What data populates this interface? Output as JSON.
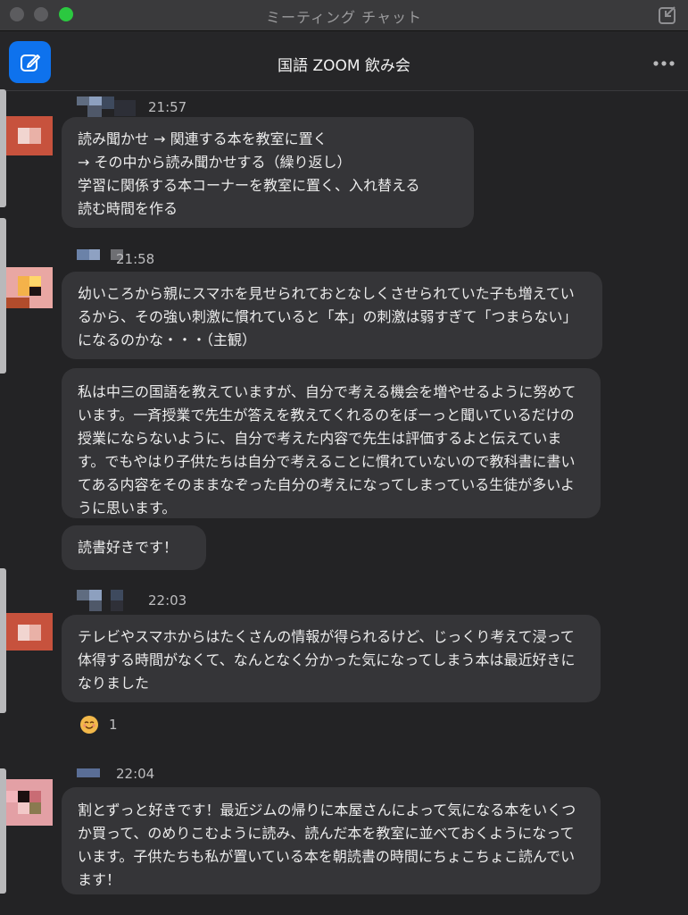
{
  "window": {
    "title": "ミーティング チャット"
  },
  "header": {
    "chat_title": "国語 ZOOM 飲み会"
  },
  "messages": [
    {
      "time": "21:57",
      "text": "読み聞かせ → 関連する本を教室に置く\n→ その中から読み聞かせする（繰り返し）\n学習に関係する本コーナーを教室に置く、入れ替える\n読む時間を作る"
    },
    {
      "time": "21:58",
      "text": "幼いころから親にスマホを見せられておとなしくさせられていた子も増えているから、その強い刺激に慣れていると「本」の刺激は弱すぎて「つまらない」になるのかな・・・（主観）"
    },
    {
      "time": "",
      "text": "私は中三の国語を教えていますが、自分で考える機会を増やせるように努めています。一斉授業で先生が答えを教えてくれるのをぼーっと聞いているだけの授業にならないように、自分で考えた内容で先生は評価するよと伝えています。でもやはり子供たちは自分で考えることに慣れていないので教科書に書いてある内容をそのままなぞった自分の考えになってしまっている生徒が多いように思います。"
    },
    {
      "time": "",
      "text": "読書好きです！"
    },
    {
      "time": "22:03",
      "text": "テレビやスマホからはたくさんの情報が得られるけど、じっくり考えて浸って体得する時間がなくて、なんとなく分かった気になってしまう本は最近好きになりました"
    },
    {
      "time": "22:04",
      "text": "割とずっと好きです！最近ジムの帰りに本屋さんによって気になる本をいくつか買って、のめりこむように読み、読んだ本を教室に並べておくようになっています。子供たちも私が置いている本を朝読書の時間にちょこちょこ読んでいます！"
    }
  ],
  "reaction": {
    "emoji": "☺",
    "count": "1"
  }
}
